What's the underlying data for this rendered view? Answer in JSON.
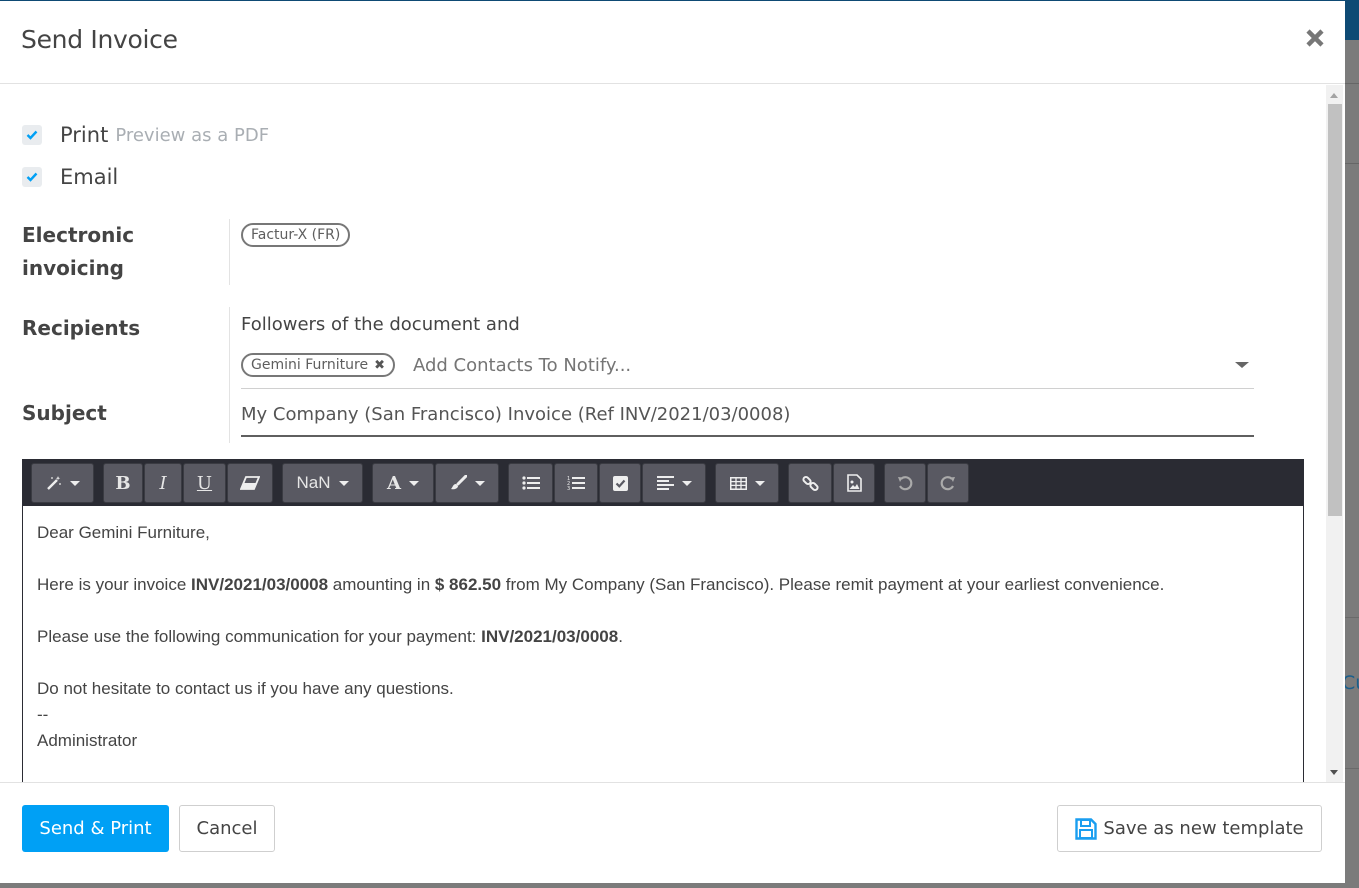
{
  "dialog": {
    "title": "Send Invoice",
    "close_icon": "close-icon"
  },
  "options": {
    "print": {
      "label": "Print",
      "hint": "Preview as a PDF",
      "checked": true
    },
    "email": {
      "label": "Email",
      "checked": true
    }
  },
  "fields": {
    "electronic_invoicing": {
      "label_line1": "Electronic",
      "label_line2": "invoicing",
      "tags": [
        "Factur-X (FR)"
      ]
    },
    "recipients": {
      "label": "Recipients",
      "prefix_text": "Followers of the document and",
      "tags": [
        "Gemini Furniture"
      ],
      "placeholder": "Add Contacts To Notify..."
    },
    "subject": {
      "label": "Subject",
      "value": "My Company (San Francisco) Invoice (Ref INV/2021/03/0008)"
    }
  },
  "toolbar": {
    "style_icon": "magic-wand-icon",
    "bold": "B",
    "italic": "I",
    "underline": "U",
    "eraser_icon": "eraser-icon",
    "font_size": "NaN",
    "font_color": "A",
    "brush_icon": "paint-brush-icon",
    "ul_icon": "bulleted-list-icon",
    "ol_icon": "numbered-list-icon",
    "checklist_icon": "checklist-icon",
    "align_icon": "align-left-icon",
    "table_icon": "table-icon",
    "link_icon": "link-icon",
    "image_icon": "image-icon",
    "undo_icon": "undo-icon",
    "redo_icon": "redo-icon"
  },
  "body": {
    "greeting": "Dear Gemini Furniture,",
    "line1_a": "Here is your invoice ",
    "invoice_ref": "INV/2021/03/0008",
    "line1_b": " amounting in ",
    "amount": "$ 862.50",
    "line1_c": " from My Company (San Francisco). Please remit payment at your earliest convenience.",
    "line2_a": "Please use the following communication for your payment: ",
    "payment_ref": "INV/2021/03/0008",
    "line2_b": ".",
    "line3": "Do not hesitate to contact us if you have any questions.",
    "signature_sep": "--",
    "signature": "Administrator"
  },
  "footer": {
    "send_print": "Send & Print",
    "cancel": "Cancel",
    "save_template": "Save as new template"
  },
  "background": {
    "partial_link": "Cu"
  },
  "colors": {
    "primary": "#00a0f5",
    "toolbar_bg": "#2a2b33",
    "toolbar_btn": "#595962",
    "check": "#00a0f5"
  }
}
